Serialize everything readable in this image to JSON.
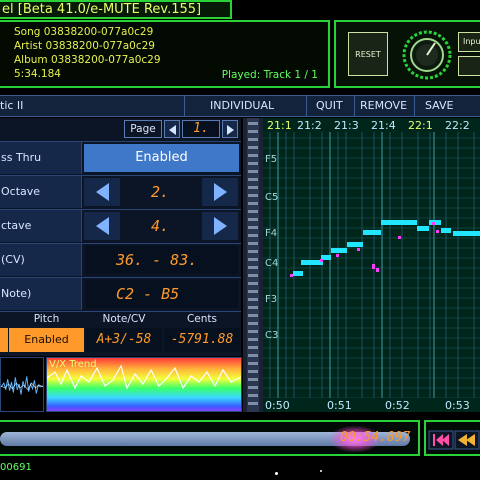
{
  "window": {
    "title": "el [Beta 41.0/e-MUTE Rev.155]"
  },
  "info": {
    "song": "Song 03838200-077a0c29",
    "artist": "Artist 03838200-077a0c29",
    "album": "Album 03838200-077a0c29",
    "time": "5:34.184",
    "played": "Played: Track 1 / 1"
  },
  "controls": {
    "reset_label": "RESET",
    "input_label": "Inpu"
  },
  "toolbar": {
    "preset": "tic II",
    "individual": "INDIVIDUAL",
    "quit": "QUIT",
    "remove": "REMOVE",
    "save": "SAVE"
  },
  "settings": {
    "page_label": "Page",
    "page_value": "1.",
    "rows": [
      {
        "label": "ss Thru",
        "value": "Enabled"
      },
      {
        "label": "Octave",
        "value": "2."
      },
      {
        "label": "ctave",
        "value": "4."
      },
      {
        "label": "(CV)",
        "value": "36. - 83."
      },
      {
        "label": "Note)",
        "value": "C2 - B5"
      }
    ],
    "table_headers": [
      "Pitch",
      "Note/CV",
      "Cents"
    ],
    "pitch_value": "Enabled",
    "notecv_value": "A+3/-58",
    "cents_value": "-5791.88",
    "spectrum_label": "V/X Trend"
  },
  "roll": {
    "bar_labels": [
      "21:1",
      "21:2",
      "21:3",
      "21:4",
      "22:1",
      "22:2"
    ],
    "note_labels": [
      "F5",
      "C5",
      "F4",
      "C4",
      "F3",
      "C3"
    ],
    "time_labels": [
      "0:50",
      "0:51",
      "0:52",
      "0:53"
    ],
    "accent_color": "#22e6ff",
    "marker_color": "#ff3cff"
  },
  "playback": {
    "position": "00:54.897",
    "progress": 0.82,
    "counter": "00691"
  },
  "colors": {
    "frame": "#2ad23a",
    "text_yellow": "#e8f050",
    "digit_orange": "#ff9a2a",
    "panel_blue": "#3f78c8"
  },
  "icons": {
    "prev": "skip-back-icon",
    "rewind": "rewind-icon",
    "left": "triangle-left-icon",
    "right": "triangle-right-icon"
  }
}
